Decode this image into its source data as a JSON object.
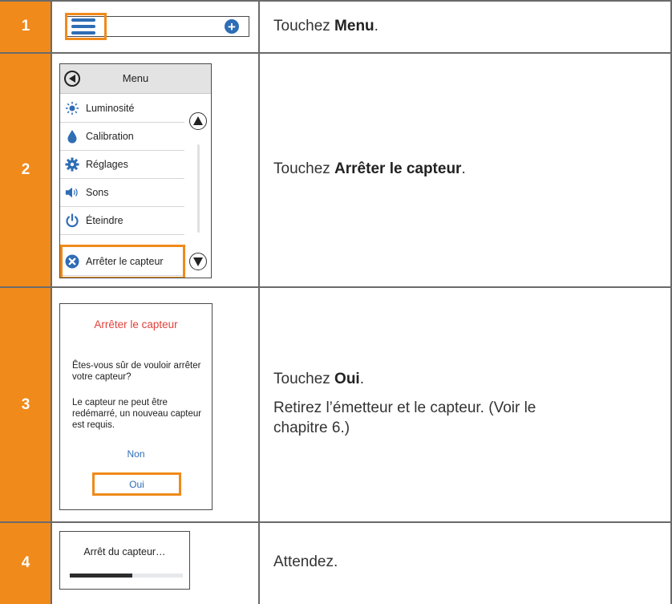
{
  "colors": {
    "step_badge": "#f08a1a",
    "highlight": "#f08a1a",
    "accent_blue": "#2f6db5",
    "alert_red": "#e0413a"
  },
  "steps": [
    {
      "number": "1",
      "screen": {
        "menu_icon": "hamburger-menu-icon",
        "add_icon": "plus-circle-icon",
        "highlighted": "menu"
      },
      "instruction": {
        "prefix": "Touchez ",
        "bold": "Menu",
        "suffix": "."
      }
    },
    {
      "number": "2",
      "screen": {
        "title": "Menu",
        "back_icon": "back-arrow-icon",
        "items": [
          {
            "label": "Luminosité",
            "icon": "sun-icon"
          },
          {
            "label": "Calibration",
            "icon": "drop-icon"
          },
          {
            "label": "Réglages",
            "icon": "gear-icon"
          },
          {
            "label": "Sons",
            "icon": "speaker-icon"
          },
          {
            "label": "Éteindre",
            "icon": "power-icon"
          },
          {
            "label": "Arrêter le capteur",
            "icon": "stop-x-icon"
          }
        ],
        "highlighted": "Arrêter le capteur"
      },
      "instruction": {
        "prefix": "Touchez ",
        "bold": "Arrêter le capteur",
        "suffix": "."
      }
    },
    {
      "number": "3",
      "screen": {
        "title": "Arrêter le capteur",
        "question": "Êtes-vous sûr de vouloir arrêter votre capteur?",
        "warning": "Le capteur ne peut être redémarré, un nouveau capteur est requis.",
        "no_label": "Non",
        "yes_label": "Oui",
        "highlighted": "Oui"
      },
      "instruction": {
        "prefix": "Touchez ",
        "bold": "Oui",
        "suffix": "."
      },
      "instruction_2": "Retirez l’émetteur et le capteur. (Voir le chapitre 6.)"
    },
    {
      "number": "4",
      "screen": {
        "label": "Arrêt du capteur…",
        "progress": 0.55
      },
      "instruction": {
        "text": "Attendez."
      }
    }
  ]
}
